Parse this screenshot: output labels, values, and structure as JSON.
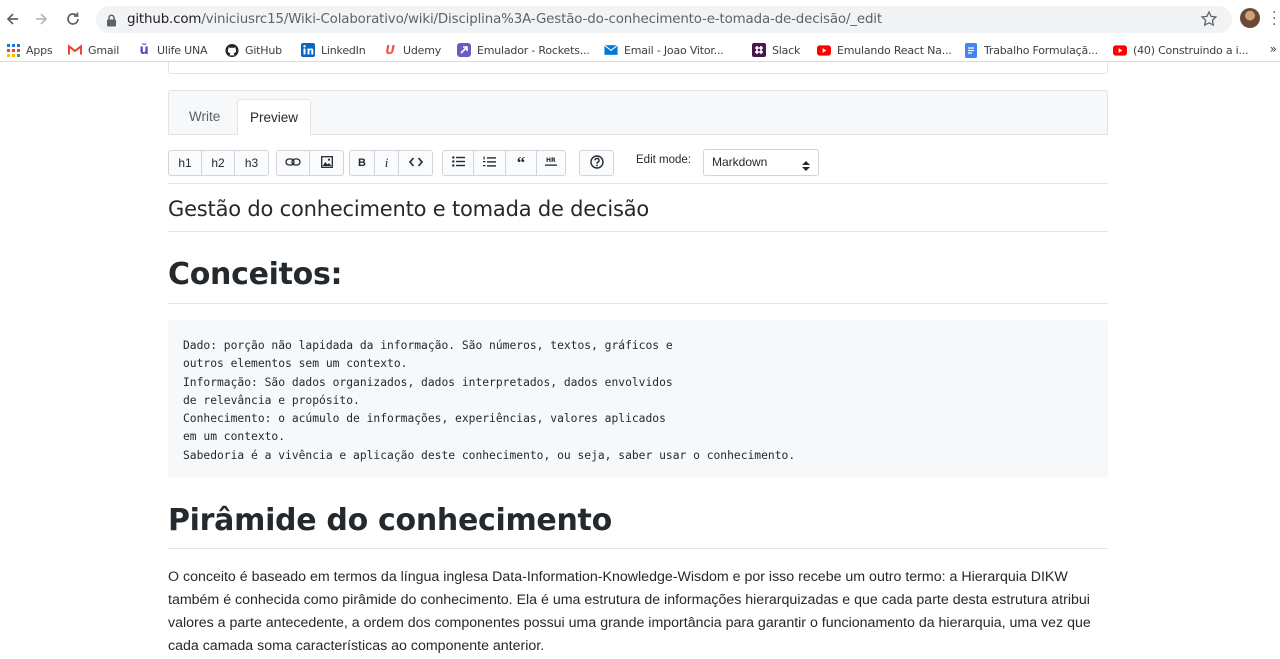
{
  "browser": {
    "url_host": "github.com",
    "url_path": "/viniciusrc15/Wiki-Colaborativo/wiki/Disciplina%3A-Gestão-do-conhecimento-e-tomada-de-decisão/_edit"
  },
  "bookmarks": [
    {
      "label": "Apps",
      "icon": "apps-grid-icon"
    },
    {
      "label": "Gmail",
      "icon": "gmail-icon",
      "color": "#EA4335"
    },
    {
      "label": "Ulife UNA",
      "icon": "ulife-icon",
      "color": "#6A3FC7"
    },
    {
      "label": "GitHub",
      "icon": "github-icon",
      "color": "#24292e"
    },
    {
      "label": "LinkedIn",
      "icon": "linkedin-icon",
      "color": "#0A66C2"
    },
    {
      "label": "Udemy",
      "icon": "udemy-icon",
      "color": "#A435F0"
    },
    {
      "label": "Emulador - Rockets...",
      "icon": "rocketseat-icon",
      "color": "#7159C1"
    },
    {
      "label": "Email - Joao Vitor...",
      "icon": "mail-icon",
      "color": "#0078D4"
    },
    {
      "label": "Slack",
      "icon": "slack-icon",
      "color": "#4A154B"
    },
    {
      "label": "Emulando React Na...",
      "icon": "youtube-icon",
      "color": "#FF0000"
    },
    {
      "label": "Trabalho Formulaçã...",
      "icon": "docs-icon",
      "color": "#4285F4"
    },
    {
      "label": "(40) Construindo a i...",
      "icon": "youtube-icon",
      "color": "#FF0000"
    }
  ],
  "bookmarks_more": "»",
  "editor": {
    "tab_write": "Write",
    "tab_preview": "Preview",
    "buttons": {
      "h1": "h1",
      "h2": "h2",
      "h3": "h3",
      "bold": "B",
      "italic": "i"
    },
    "edit_mode_label": "Edit mode:",
    "edit_mode_value": "Markdown"
  },
  "preview": {
    "page_title": "Gestão do conhecimento e tomada de decisão",
    "heading_1": "Conceitos:",
    "code_lines": [
      "Dado: porção não lapidada da informação. São números, textos, gráficos e",
      "outros elementos sem um contexto.",
      "Informação: São dados organizados, dados interpretados, dados envolvidos",
      "de relevância e propósito.",
      "Conhecimento: o acúmulo de informações, experiências, valores aplicados",
      "em um contexto.",
      "Sabedoria é a vivência e aplicação deste conhecimento, ou seja, saber usar o conhecimento."
    ],
    "heading_2": "Pirâmide do conhecimento",
    "paragraph": "O conceito é baseado em termos da língua inglesa Data-Information-Knowledge-Wisdom e por isso recebe um outro termo: a Hierarquia DIKW também é conhecida como pirâmide do conhecimento. Ela é uma estrutura de informações hierarquizadas e que cada parte desta estrutura atribui valores a parte antecedente, a ordem dos componentes possui uma grande importância para garantir o funcionamento da hierarquia, uma vez que cada camada soma características ao componente anterior."
  }
}
